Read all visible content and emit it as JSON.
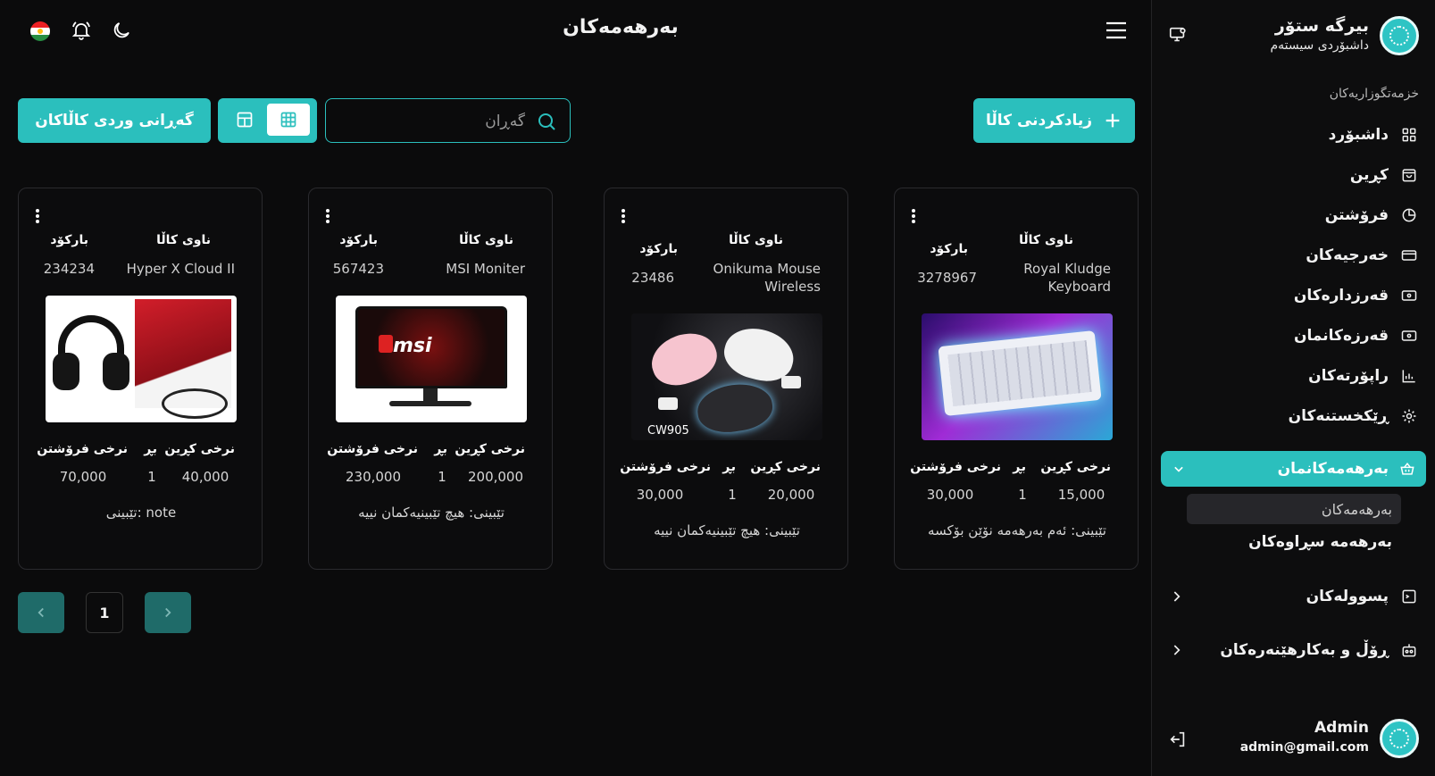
{
  "header": {
    "title": "بەرهەمەکان"
  },
  "toolbar": {
    "add_label": "زیادکردنی کاڵا",
    "search_placeholder": "گەڕان",
    "import_label": "گەڕانی وردی کاڵاکان"
  },
  "sidebar": {
    "brand_name": "بیرگە ستۆر",
    "brand_sub": "داشبۆردی سیستەم",
    "section_title": "خزمەتگوزاریەکان",
    "items": [
      {
        "label": "داشبۆرد",
        "icon": "dashboard-icon"
      },
      {
        "label": "کڕین",
        "icon": "shopping-bag-icon"
      },
      {
        "label": "فرۆشتن",
        "icon": "pie-chart-icon"
      },
      {
        "label": "خەرجیەکان",
        "icon": "credit-card-icon"
      },
      {
        "label": "قەرزدارەکان",
        "icon": "wallet-icon"
      },
      {
        "label": "قەرزەکانمان",
        "icon": "wallet-icon"
      },
      {
        "label": "راپۆرتەکان",
        "icon": "report-icon"
      },
      {
        "label": "ڕێکخستنەکان",
        "icon": "settings-icon"
      }
    ],
    "active_group": {
      "label": "بەرهەمەکانمان",
      "icon": "basket-icon"
    },
    "sub_items": [
      {
        "label": "بەرهەمەکان"
      },
      {
        "label": "بەرهەمە سڕاوەکان"
      }
    ],
    "expandables": [
      {
        "label": "پسوولەکان",
        "icon": "receipt-icon"
      },
      {
        "label": "ڕۆڵ و بەکارهێنەرەکان",
        "icon": "users-icon"
      }
    ],
    "user": {
      "name": "Admin",
      "email": "admin@gmail.com"
    }
  },
  "cards_labels": {
    "name_label": "ناوی کاڵا",
    "barcode_label": "بارکۆد",
    "buy_label": "نرخی کڕین",
    "qty_label": "بڕ",
    "sell_label": "نرخی فرۆشتن"
  },
  "products": [
    {
      "name": "Royal Kludge Keyboard",
      "barcode": "3278967",
      "buy": "15,000",
      "qty": "1",
      "sell": "30,000",
      "note": "تێبینی: ئەم بەرهەمە نۆێن بۆکسە"
    },
    {
      "name": "Onikuma Mouse Wireless",
      "barcode": "23486",
      "buy": "20,000",
      "qty": "1",
      "sell": "30,000",
      "note": "تێبینی: هیچ تێبینیەکمان نییە"
    },
    {
      "name": "MSI Moniter",
      "barcode": "567423",
      "buy": "200,000",
      "qty": "1",
      "sell": "230,000",
      "note": "تێبینی: هیچ تێبینیەکمان نییە"
    },
    {
      "name": "Hyper X Cloud II",
      "barcode": "234234",
      "buy": "40,000",
      "qty": "1",
      "sell": "70,000",
      "note": "تێبینی: note"
    }
  ],
  "pagination": {
    "current": "1"
  },
  "colors": {
    "accent": "#2bbfbd",
    "background": "#0b0b0c"
  }
}
